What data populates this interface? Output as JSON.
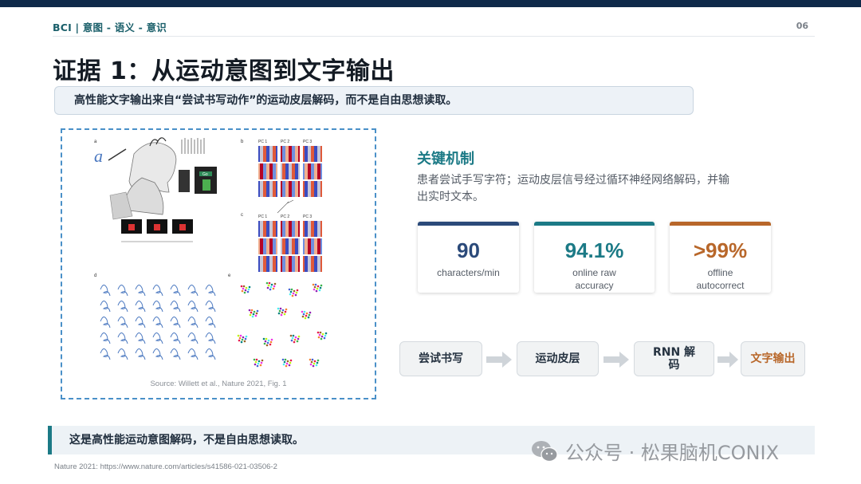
{
  "header": {
    "breadcrumb": "BCI | 意图 - 语义 - 意识",
    "page_number": "06"
  },
  "title": "证据 1：从运动意图到文字输出",
  "subtitle": "高性能文字输出来自“尝试书写动作”的运动皮层解码，而不是自由思想读取。",
  "figure": {
    "source": "Source: Willett et al., Nature 2021, Fig. 1",
    "panel_labels": [
      "a",
      "b",
      "c",
      "d",
      "e"
    ],
    "pc_labels": [
      "PC 1",
      "PC 2",
      "PC 3"
    ],
    "trial_labels": [
      "Go"
    ]
  },
  "mechanism": {
    "heading": "关键机制",
    "description": "患者尝试手写字符；运动皮层信号经过循环神经网络解码，并输出实时文本。"
  },
  "metrics": [
    {
      "value": "90",
      "label": "characters/min",
      "color": "#2b4a7a"
    },
    {
      "value": "94.1%",
      "label": "online raw accuracy",
      "color": "#1c7a86"
    },
    {
      "value": ">99%",
      "label": "offline autocorrect",
      "color": "#b8672a"
    }
  ],
  "flow": [
    {
      "label": "尝试书写"
    },
    {
      "label": "运动皮层"
    },
    {
      "label": "RNN 解码"
    },
    {
      "label": "文字输出",
      "color": "#b8672a"
    }
  ],
  "bottom_note": "这是高性能运动意图解码，不是自由思想读取。",
  "footnote": "Nature 2021: https://www.nature.com/articles/s41586-021-03506-2",
  "watermark": "公众号 · 松果脑机CONIX",
  "colors": {
    "accent": "#1c7a86",
    "navy": "#0f2a4a",
    "orange": "#b8672a",
    "dashed_border": "#4a90c8"
  }
}
